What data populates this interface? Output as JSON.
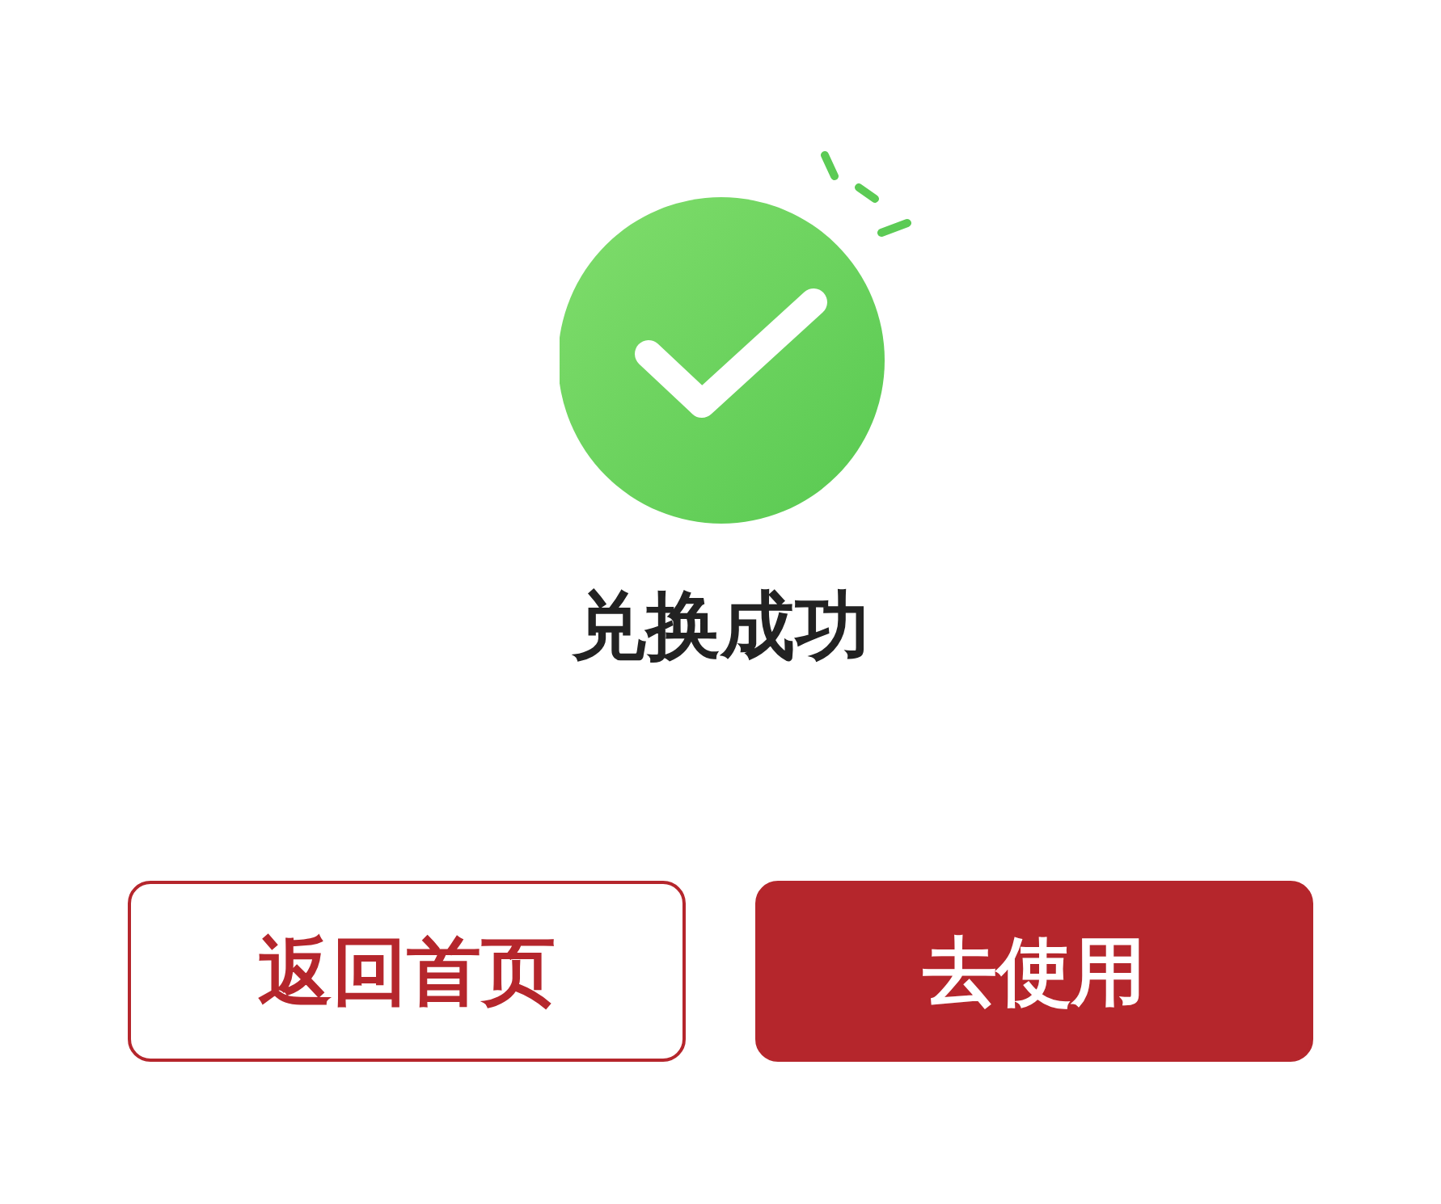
{
  "status": {
    "title": "兑换成功"
  },
  "buttons": [
    {
      "label": "返回首页",
      "kind": "outline"
    },
    {
      "label": "去使用",
      "kind": "filled"
    }
  ]
}
